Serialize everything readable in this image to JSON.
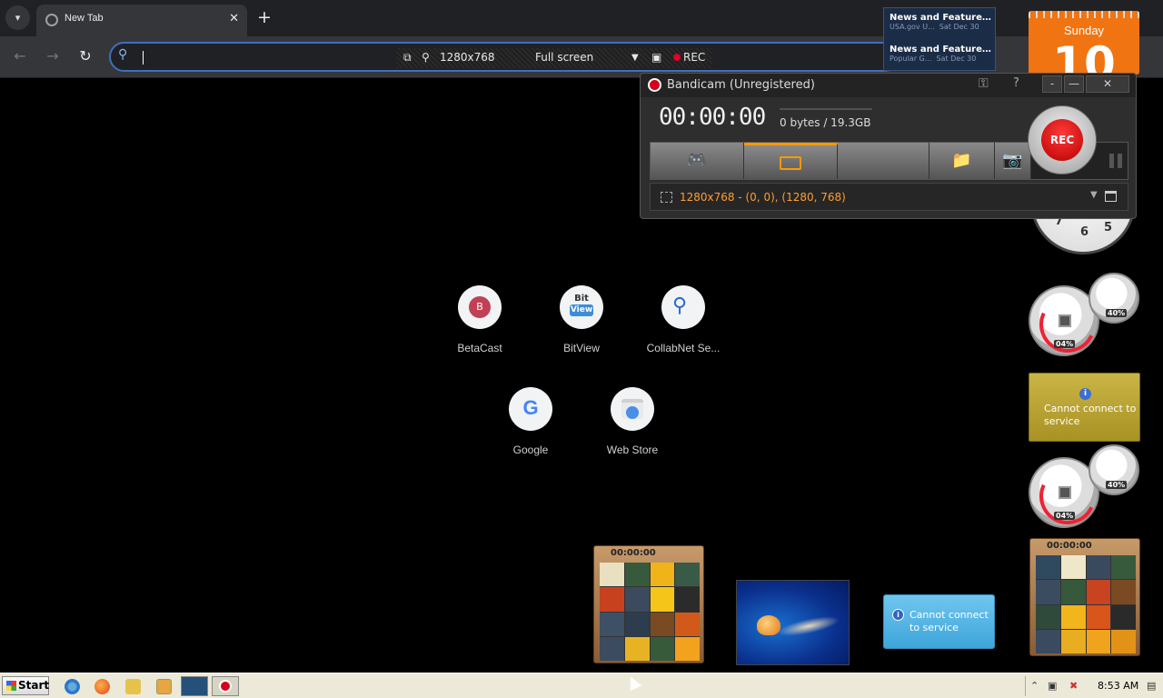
{
  "browser": {
    "tab_title": "New Tab",
    "tab_close": "✕",
    "new_tab": "+",
    "back": "←",
    "forward": "→",
    "reload": "↻"
  },
  "bandicam_bar": {
    "resolution": "1280x768",
    "mode": "Full screen",
    "rec": "REC"
  },
  "shortcuts": [
    {
      "label": "BetaCast",
      "icon": "B"
    },
    {
      "label": "BitView",
      "icon_top": "Bit",
      "icon_bottom": "View"
    },
    {
      "label": "CollabNet Se..."
    },
    {
      "label": "Google",
      "icon": "G"
    },
    {
      "label": "Web Store"
    }
  ],
  "bandicam": {
    "title": "Bandicam (Unregistered)",
    "help": "?",
    "min1": "-",
    "min2": "—",
    "close": "✕",
    "timer": "00:00:00",
    "bytes": "0 bytes / 19.3GB",
    "rec": "REC",
    "region": "1280x768 - (0, 0), (1280, 768)"
  },
  "news": [
    {
      "title": "News and Features f...",
      "source": "USA.gov U...",
      "date": "Sat Dec 30"
    },
    {
      "title": "News and Features f...",
      "source": "Popular G...",
      "date": "Sat Dec 30"
    }
  ],
  "calendar": {
    "day": "Sunday",
    "number": "10"
  },
  "clock_numbers": [
    "7",
    "6",
    "5"
  ],
  "meters": [
    {
      "big_pct": "04%",
      "small_pct": "40%"
    },
    {
      "big_pct": "04%",
      "small_pct": "40%"
    }
  ],
  "service": {
    "message": "Cannot connect to service",
    "info": "i"
  },
  "puzzles": [
    {
      "time": "00:00:00"
    },
    {
      "time": "00:00:00"
    }
  ],
  "taskbar": {
    "start": "Start",
    "time": "8:53 AM"
  },
  "colors": {
    "accent_orange": "#ff9800",
    "rec_red": "#d6001c",
    "omnibox_border": "#3f6ec0"
  }
}
